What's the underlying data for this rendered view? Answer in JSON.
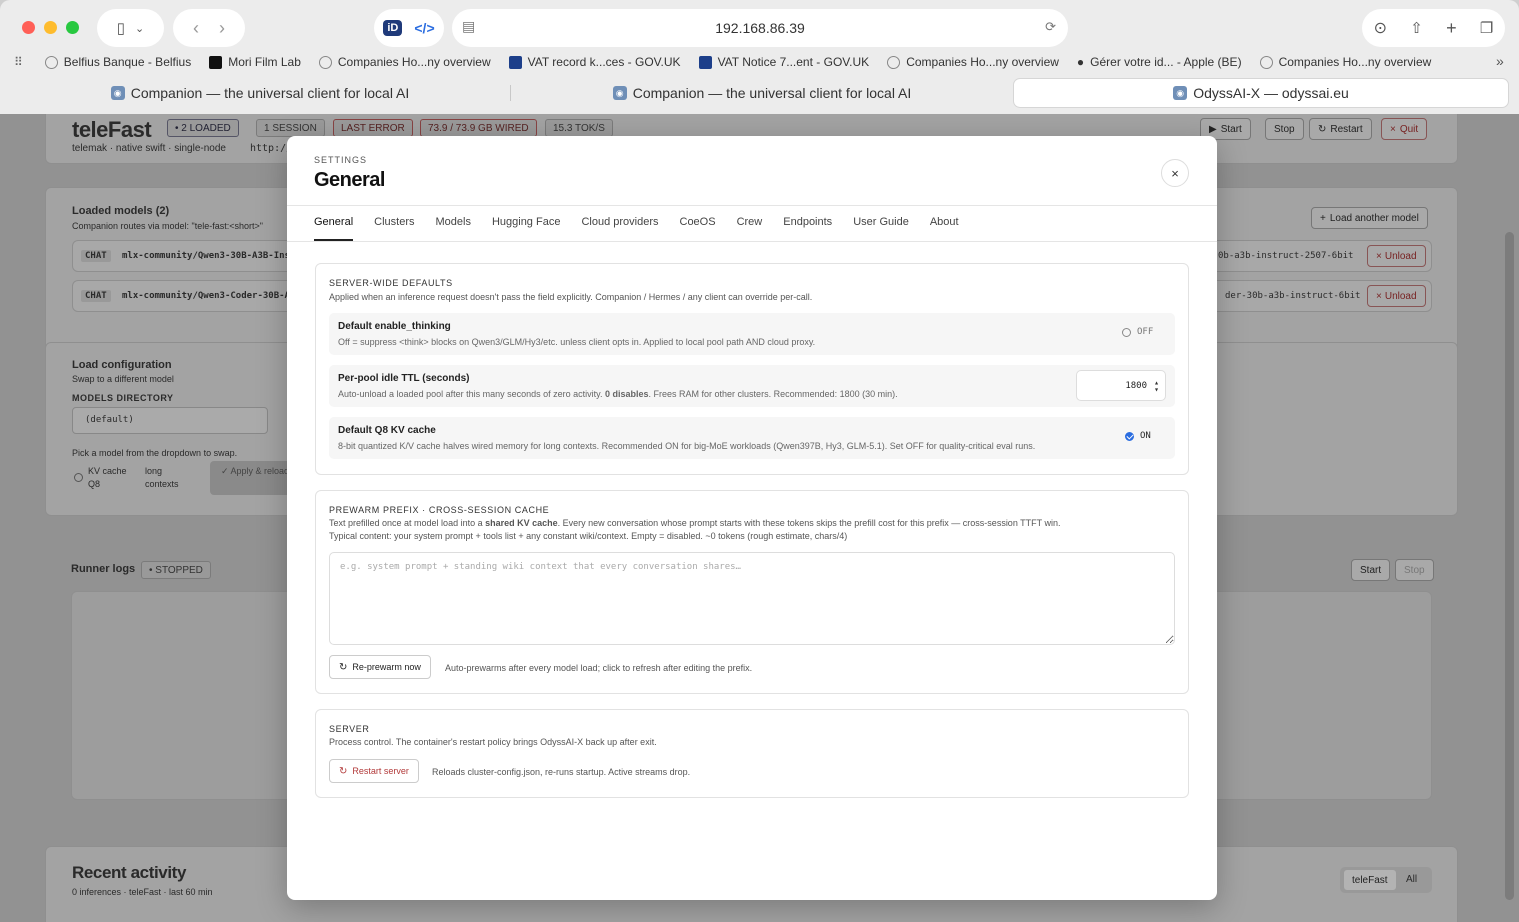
{
  "browser": {
    "address": "192.168.86.39",
    "bookmarks": [
      {
        "label": "Belfius Banque - Belfius",
        "icon": "globe-icon"
      },
      {
        "label": "Mori Film Lab",
        "icon": "mori-logo-icon"
      },
      {
        "label": "Companies Ho...ny overview",
        "icon": "globe-icon"
      },
      {
        "label": "VAT record k...ces - GOV.UK",
        "icon": "govuk-icon"
      },
      {
        "label": "VAT Notice 7...ent - GOV.UK",
        "icon": "govuk-icon"
      },
      {
        "label": "Companies Ho...ny overview",
        "icon": "globe-icon"
      },
      {
        "label": "Gérer votre id... - Apple (BE)",
        "icon": "apple-icon"
      },
      {
        "label": "Companies Ho...ny overview",
        "icon": "globe-icon"
      }
    ],
    "tabs": [
      {
        "label": "Companion — the universal client for local AI",
        "active": false
      },
      {
        "label": "Companion — the universal client for local AI",
        "active": false
      },
      {
        "label": "OdyssAI-X — odyssai.eu",
        "active": true
      }
    ]
  },
  "background": {
    "title": "teleFast",
    "badges": [
      "• 2 LOADED",
      "1 SESSION",
      "LAST ERROR",
      "73.9 / 73.9 GB WIRED",
      "15.3 TOK/S"
    ],
    "subtitle": "telemak · native swift · single-node",
    "url_fragment": "http://",
    "header_buttons": [
      "Start",
      "Stop",
      "Restart",
      "Quit"
    ],
    "loaded_models_title": "Loaded models (2)",
    "loaded_models_desc": "Companion routes via model: \"tele-fast:<short>\"",
    "load_another": "Load another model",
    "models": [
      {
        "kind": "CHAT",
        "name": "mlx-community/Qwen3-30B-A3B-Ins",
        "tail": "0b-a3b-instruct-2507-6bit",
        "action": "Unload"
      },
      {
        "kind": "CHAT",
        "name": "mlx-community/Qwen3-Coder-30B-A",
        "tail": "der-30b-a3b-instruct-6bit",
        "action": "Unload"
      }
    ],
    "load_config_title": "Load configuration",
    "load_config_desc": "Swap to a different model",
    "models_dir_label": "MODELS DIRECTORY",
    "models_dir_value": "(default)",
    "pick_hint": "Pick a model from the dropdown to swap.",
    "kv_label": "KV cache Q8",
    "long_ctx": "long contexts",
    "apply_btn": "✓ Apply & reload",
    "runner_logs": "Runner logs",
    "runner_status": "• STOPPED",
    "runner_start": "Start",
    "runner_stop": "Stop",
    "recent_title": "Recent activity",
    "recent_desc": "0 inferences · teleFast · last 60 min",
    "recent_filters": [
      "teleFast",
      "All"
    ]
  },
  "modal": {
    "eyebrow": "SETTINGS",
    "title": "General",
    "close": "×",
    "tabs": [
      "General",
      "Clusters",
      "Models",
      "Hugging Face",
      "Cloud providers",
      "CoeOS",
      "Crew",
      "Endpoints",
      "User Guide",
      "About"
    ],
    "defaults": {
      "heading": "SERVER-WIDE DEFAULTS",
      "desc": "Applied when an inference request doesn't pass the field explicitly. Companion / Hermes / any client can override per-call.",
      "thinking": {
        "title": "Default enable_thinking",
        "desc": "Off = suppress <think> blocks on Qwen3/GLM/Hy3/etc. unless client opts in. Applied to local pool path AND cloud proxy.",
        "state": "OFF"
      },
      "ttl": {
        "title": "Per-pool idle TTL (seconds)",
        "desc_a": "Auto-unload a loaded pool after this many seconds of zero activity. ",
        "desc_b": "0 disables",
        "desc_c": ". Frees RAM for other clusters. Recommended: 1800 (30 min).",
        "value": "1800"
      },
      "kv": {
        "title": "Default Q8 KV cache",
        "desc": "8-bit quantized K/V cache halves wired memory for long contexts. Recommended ON for big-MoE workloads (Qwen397B, Hy3, GLM-5.1). Set OFF for quality-critical eval runs.",
        "state": "ON"
      }
    },
    "prewarm": {
      "heading": "PREWARM PREFIX · CROSS-SESSION CACHE",
      "desc1_a": "Text prefilled once at model load into a ",
      "desc1_b": "shared KV cache",
      "desc1_c": ". Every new conversation whose prompt starts with these tokens skips the prefill cost for this prefix — cross-session TTFT win.",
      "desc2": "Typical content: your system prompt + tools list + any constant wiki/context. Empty = disabled. ~0 tokens (rough estimate, chars/4)",
      "placeholder": "e.g. system prompt + standing wiki context that every conversation shares…",
      "button": "Re-prewarm now",
      "hint": "Auto-prewarms after every model load; click to refresh after editing the prefix."
    },
    "server": {
      "heading": "SERVER",
      "desc": "Process control. The container's restart policy brings OdyssAI-X back up after exit.",
      "button": "Restart server",
      "hint": "Reloads cluster-config.json, re-runs startup. Active streams drop."
    }
  },
  "colors": {
    "accent": "#2b6de0",
    "danger": "#b23a3a"
  }
}
